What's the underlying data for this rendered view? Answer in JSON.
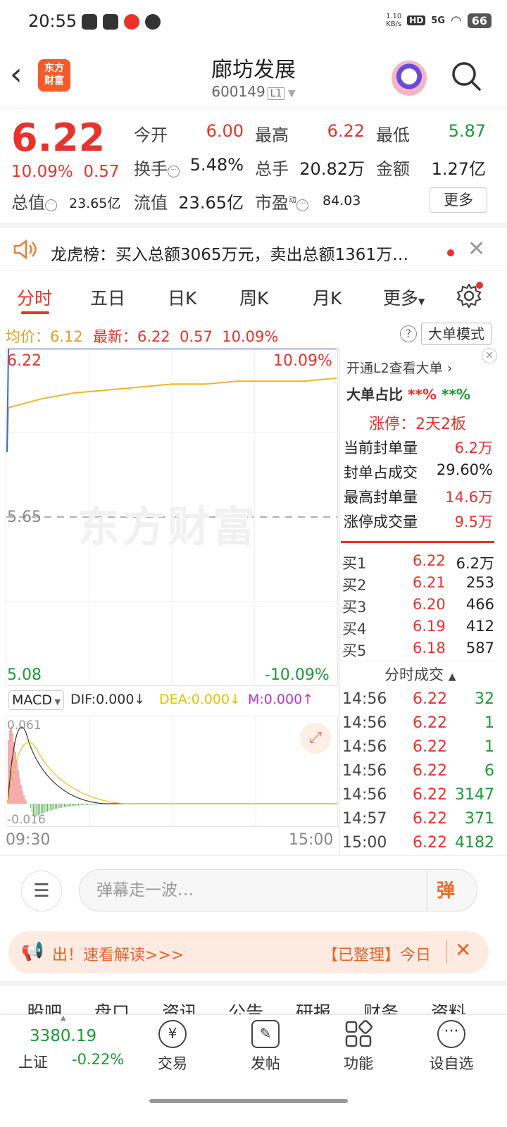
{
  "status_bar": {
    "time": "20:55",
    "net_speed_top": "1.10",
    "net_speed_unit": "KB/s",
    "hd": "HD",
    "signal": "5G",
    "battery": "66"
  },
  "header": {
    "back_icon": "chevron-left-icon",
    "logo_line1": "东方",
    "logo_line2": "财富",
    "title": "廊坊发展",
    "code": "600149",
    "level_badge": "L1",
    "search_icon": "search-icon"
  },
  "quote": {
    "price": "6.22",
    "change_pct": "10.09%",
    "change_amt": "0.57",
    "open_label": "今开",
    "open": "6.00",
    "high_label": "最高",
    "high": "6.22",
    "low_label": "最低",
    "low": "5.87",
    "turnover_label": "换手",
    "turnover": "5.48%",
    "volume_label": "总手",
    "volume": "20.82万",
    "amount_label": "金额",
    "amount": "1.27亿",
    "mktcap_label": "总值",
    "mktcap": "23.65亿",
    "float_label": "流值",
    "float": "23.65亿",
    "pe_label": "市盈",
    "pe_sup": "动",
    "pe": "84.03",
    "more_label": "更多"
  },
  "notice": {
    "text": "龙虎榜：买入总额3065万元，卖出总额1361万…"
  },
  "tabs": [
    "分时",
    "五日",
    "日K",
    "周K",
    "月K",
    "更多"
  ],
  "infoline": {
    "avg_label": "均价：",
    "avg": "6.12",
    "latest_label": "最新：",
    "latest": "6.22",
    "chg": "0.57",
    "pct": "10.09%",
    "help": "?",
    "big_mode": "大单模式"
  },
  "chart": {
    "top_price": "6.22",
    "top_pct": "10.09%",
    "mid_price": "5.65",
    "bottom_price": "5.08",
    "bottom_pct": "-10.09%",
    "start_time": "09:30",
    "end_time": "15:00",
    "watermark": "东方财富"
  },
  "macd": {
    "name": "MACD",
    "dif": "DIF:0.000",
    "dea": "DEA:0.000",
    "m": "M:0.000",
    "top_val": "0.061",
    "bottom_val": "-0.016"
  },
  "side": {
    "l2_link": "开通L2查看大单",
    "big_ratio_label": "大单占比",
    "big_ratio_buy": "**%",
    "big_ratio_sell": "**%",
    "limit_up": "涨停：2天2板",
    "rows": [
      {
        "label": "当前封单量",
        "value": "6.2万"
      },
      {
        "label": "封单占成交",
        "value": "29.60%"
      },
      {
        "label": "最高封单量",
        "value": "14.6万"
      },
      {
        "label": "涨停成交量",
        "value": "9.5万"
      }
    ],
    "book": [
      {
        "label": "买1",
        "price": "6.22",
        "vol": "6.2万"
      },
      {
        "label": "买2",
        "price": "6.21",
        "vol": "253"
      },
      {
        "label": "买3",
        "price": "6.20",
        "vol": "466"
      },
      {
        "label": "买4",
        "price": "6.19",
        "vol": "412"
      },
      {
        "label": "买5",
        "price": "6.18",
        "vol": "587"
      }
    ],
    "trades_title": "分时成交",
    "trades": [
      {
        "time": "14:56",
        "price": "6.22",
        "vol": "32"
      },
      {
        "time": "14:56",
        "price": "6.22",
        "vol": "1"
      },
      {
        "time": "14:56",
        "price": "6.22",
        "vol": "1"
      },
      {
        "time": "14:56",
        "price": "6.22",
        "vol": "6"
      },
      {
        "time": "14:56",
        "price": "6.22",
        "vol": "3147"
      },
      {
        "time": "14:57",
        "price": "6.22",
        "vol": "371"
      },
      {
        "time": "15:00",
        "price": "6.22",
        "vol": "4182"
      }
    ]
  },
  "danmu": {
    "placeholder": "弹幕走一波…",
    "button": "弹"
  },
  "banner": {
    "left": "出！速看解读>>>",
    "right": "【已整理】今日"
  },
  "subtabs": [
    "股吧",
    "盘口",
    "资讯",
    "公告",
    "研报",
    "财务",
    "资料"
  ],
  "bottom_nav": {
    "index_value": "3380.19",
    "index_name": "上证",
    "index_pct": "-0.22%",
    "items": [
      "交易",
      "发帖",
      "功能",
      "设自选"
    ]
  },
  "chart_data": {
    "type": "line",
    "title": "",
    "x_range": [
      "09:30",
      "15:00"
    ],
    "ylim": [
      5.08,
      6.22
    ],
    "reference": 5.65,
    "series": [
      {
        "name": "均价",
        "color": "#f0b429",
        "values": [
          5.87,
          6.02,
          6.05,
          6.07,
          6.08,
          6.09,
          6.1,
          6.1,
          6.11,
          6.11,
          6.11,
          6.12
        ]
      },
      {
        "name": "最新",
        "color": "#3b6fd1",
        "values": [
          5.87,
          6.22,
          6.22,
          6.22,
          6.22,
          6.22,
          6.22,
          6.22,
          6.22,
          6.22,
          6.22,
          6.22
        ]
      }
    ]
  }
}
